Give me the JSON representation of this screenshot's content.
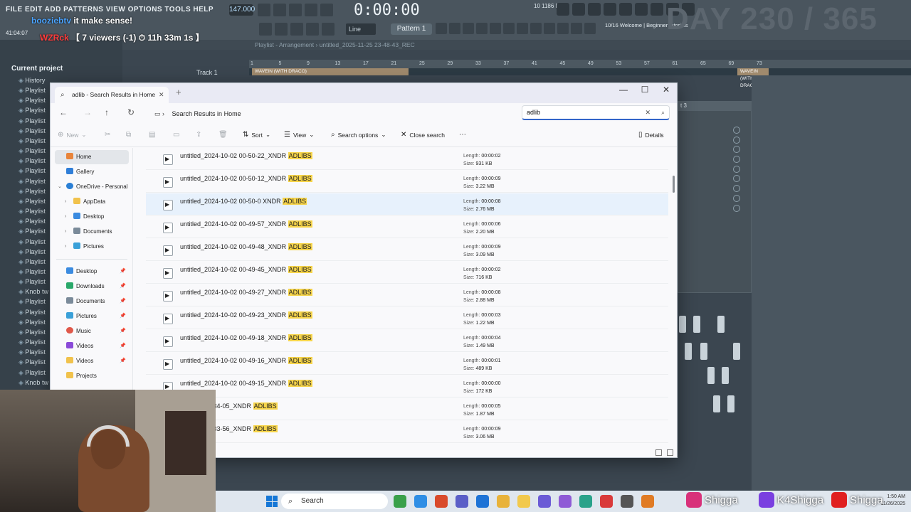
{
  "fl_studio": {
    "menu": "FILE EDIT ADD PATTERNS VIEW OPTIONS TOOLS HELP",
    "tempo": "147.000",
    "time": "0:00:00",
    "line_mode": "Line",
    "pattern": "Pattern 1",
    "cpu_mem": "10    1186 MB",
    "cpu_zero": "0",
    "hint_count": "10/16",
    "hint_text": "Welcome | Beginner tutorials",
    "playlist_title": "Playlist - Arrangement › untitled_2025-11-25 23-48-43_REC",
    "track1": "Track 1",
    "clip_label": "WAVEIN (WITH DRACO)",
    "timer": "41:04:07",
    "browser_title": "Current project",
    "browser_items": [
      "History",
      "Playlist",
      "Playlist",
      "Playlist",
      "Playlist",
      "Playlist",
      "Playlist",
      "Playlist",
      "Playlist",
      "Playlist",
      "Playlist",
      "Playlist",
      "Playlist",
      "Playlist",
      "Playlist",
      "Playlist",
      "Playlist",
      "Playlist",
      "Playlist",
      "Playlist",
      "Playlist",
      "Knob tw",
      "Playlist",
      "Playlist",
      "Playlist",
      "Playlist",
      "Playlist",
      "Playlist",
      "Playlist",
      "Playlist",
      "Knob tw"
    ],
    "ruler": [
      "1",
      "5",
      "9",
      "13",
      "17",
      "21",
      "25",
      "29",
      "33",
      "37",
      "41",
      "45",
      "49",
      "53",
      "57",
      "61",
      "65",
      "69",
      "73"
    ],
    "right_panel_title": "t 3"
  },
  "stream": {
    "day_counter": "DAY 230 / 365",
    "chat_user": "booziebtv",
    "chat_message": "it make sense!",
    "viewers_tag": "WZRck",
    "viewers_text": "【 7 viewers (-1) ⏱ 11h 33m 1s 】",
    "socials": [
      {
        "name": "Shigga",
        "color": "#d8317a"
      },
      {
        "name": "K4Shigga",
        "color": "#7a3fe0"
      },
      {
        "name": "Shigga",
        "color": "#e02020"
      }
    ]
  },
  "explorer": {
    "tab_title": "adlib - Search Results in Home",
    "breadcrumb": "Search Results in Home",
    "search_value": "adlib",
    "toolbar": {
      "new": "New",
      "sort": "Sort",
      "view": "View",
      "search_options": "Search options",
      "close_search": "Close search",
      "details": "Details"
    },
    "sidebar": {
      "home": "Home",
      "gallery": "Gallery",
      "onedrive": "OneDrive - Personal",
      "appdata": "AppData",
      "desktop1": "Desktop",
      "documents1": "Documents",
      "pictures1": "Pictures",
      "desktop2": "Desktop",
      "downloads": "Downloads",
      "documents2": "Documents",
      "pictures2": "Pictures",
      "music": "Music",
      "videos1": "Videos",
      "videos2": "Videos",
      "projects": "Projects"
    },
    "highlight_word": "ADLIBS",
    "length_label": "Length:",
    "size_label": "Size:",
    "files": [
      {
        "prefix": "untitled_2024-10-02 00-50-22_XNDR ",
        "length": "00:00:02",
        "size": "931 KB"
      },
      {
        "prefix": "untitled_2024-10-02 00-50-12_XNDR ",
        "length": "00:00:09",
        "size": "3.22 MB"
      },
      {
        "prefix": "untitled_2024-10-02 00-50-0 XNDR ",
        "length": "00:00:08",
        "size": "2.76 MB"
      },
      {
        "prefix": "untitled_2024-10-02 00-49-57_XNDR ",
        "length": "00:00:06",
        "size": "2.20 MB"
      },
      {
        "prefix": "untitled_2024-10-02 00-49-48_XNDR ",
        "length": "00:00:09",
        "size": "3.09 MB"
      },
      {
        "prefix": "untitled_2024-10-02 00-49-45_XNDR ",
        "length": "00:00:02",
        "size": "716 KB"
      },
      {
        "prefix": "untitled_2024-10-02 00-49-27_XNDR ",
        "length": "00:00:08",
        "size": "2.88 MB"
      },
      {
        "prefix": "untitled_2024-10-02 00-49-23_XNDR ",
        "length": "00:00:03",
        "size": "1.22 MB"
      },
      {
        "prefix": "untitled_2024-10-02 00-49-18_XNDR ",
        "length": "00:00:04",
        "size": "1.49 MB"
      },
      {
        "prefix": "untitled_2024-10-02 00-49-16_XNDR ",
        "length": "00:00:01",
        "size": "489 KB"
      },
      {
        "prefix": "untitled_2024-10-02 00-49-15_XNDR ",
        "length": "00:00:00",
        "size": "172 KB"
      },
      {
        "prefix": "4-09-17 00-34-05_XNDR ",
        "length": "00:00:05",
        "size": "1.87 MB"
      },
      {
        "prefix": "4-09-17 00-33-56_XNDR ",
        "length": "00:00:09",
        "size": "3.06 MB"
      }
    ]
  },
  "taskbar": {
    "search_placeholder": "Search",
    "time": "1:50 AM",
    "date": "11/26/2025",
    "app_colors": [
      "#3aa04a",
      "#2f8ee5",
      "#d94a2b",
      "#5b5fc7",
      "#1e73d6",
      "#e8b23a",
      "#f2c94c",
      "#6b5bd6",
      "#8f5bd6",
      "#2aa28a",
      "#d93a3a",
      "#555555",
      "#e07b24"
    ]
  },
  "colors": {
    "accent": "#3466c9",
    "highlight": "#f6d44a",
    "selected_row": "#e7f1fc"
  }
}
